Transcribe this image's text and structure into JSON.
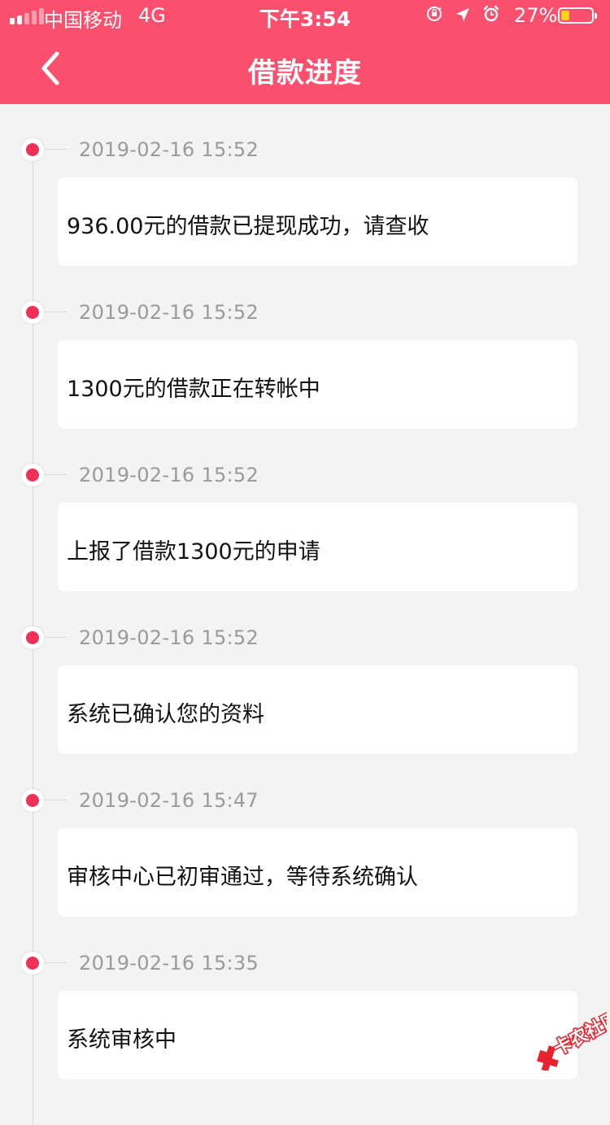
{
  "status_bar": {
    "carrier": "中国移动",
    "network": "4G",
    "time": "下午3:54",
    "battery_percent": "27%",
    "battery_level": 0.27,
    "icons": [
      "orientation-lock-icon",
      "location-arrow-icon",
      "alarm-icon"
    ]
  },
  "header": {
    "title": "借款进度",
    "back_icon": "chevron-left-icon",
    "background_color": "#fb4f6e"
  },
  "timeline": [
    {
      "timestamp": "2019-02-16 15:52",
      "message": "936.00元的借款已提现成功，请查收"
    },
    {
      "timestamp": "2019-02-16 15:52",
      "message": "1300元的借款正在转帐中"
    },
    {
      "timestamp": "2019-02-16 15:52",
      "message": "上报了借款1300元的申请"
    },
    {
      "timestamp": "2019-02-16 15:52",
      "message": "系统已确认您的资料"
    },
    {
      "timestamp": "2019-02-16 15:47",
      "message": "审核中心已初审通过，等待系统确认"
    },
    {
      "timestamp": "2019-02-16 15:35",
      "message": "系统审核中"
    }
  ],
  "watermark": {
    "text": "卡农社区",
    "icon": "kanong-logo-icon"
  },
  "colors": {
    "accent": "#fb4f6e",
    "dot": "#f0305a",
    "background": "#f3f3f3"
  }
}
